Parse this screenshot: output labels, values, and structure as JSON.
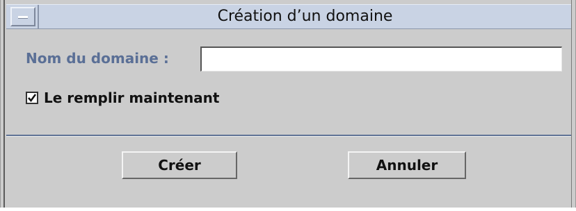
{
  "window": {
    "title": "Création d’un domaine",
    "menu_icon": "window-menu-icon"
  },
  "form": {
    "name_label": "Nom du domaine :",
    "name_value": "",
    "name_placeholder": "",
    "fill_now_label": "Le remplir maintenant",
    "fill_now_checked": true
  },
  "buttons": {
    "create_label": "Créer",
    "cancel_label": "Annuler"
  },
  "colors": {
    "title_bar": "#c9d3e4",
    "label_accent": "#5a6f96",
    "window_bg": "#cccccc",
    "divider": "#5f7396"
  }
}
